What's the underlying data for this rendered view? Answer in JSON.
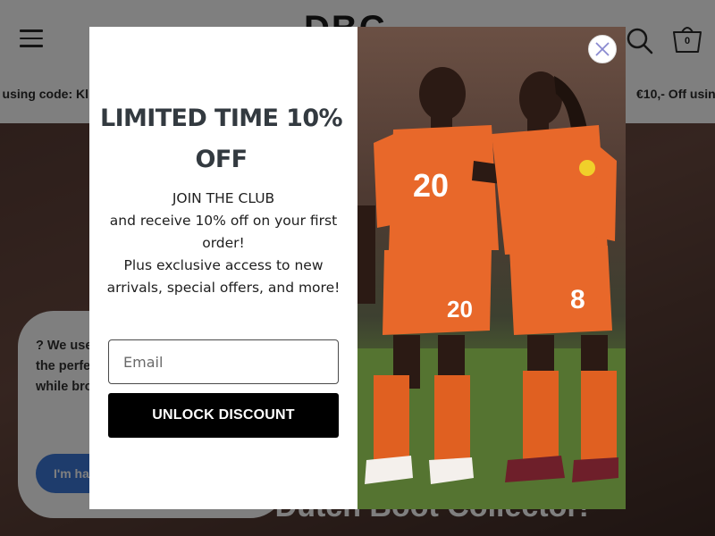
{
  "header": {
    "logo_text": "DBC",
    "cart_count": "0"
  },
  "announcement": {
    "left_text": "f using code: Kl",
    "right_text": "€10,- Off usin"
  },
  "hero": {
    "title": "Welcome to Dutch Boot Collector!"
  },
  "cookie_banner": {
    "text": "? We use cookies for rare finds and the perfect personalized experience while browsing",
    "accept_label": "I'm happy"
  },
  "popup": {
    "title": "LIMITED TIME 10% OFF",
    "line1": "JOIN THE CLUB",
    "line2": "and receive 10% off on your first order!",
    "line3": "Plus exclusive access to new arrivals, special offers, and more!",
    "email_placeholder": "Email",
    "email_value": "",
    "button_label": "UNLOCK DISCOUNT",
    "players": {
      "left_number": "20",
      "right_number": "8"
    }
  },
  "colors": {
    "jersey": "#e8682a",
    "overlay": "rgba(0,0,0,0.5)",
    "button_bg": "#000000",
    "close_x": "#8a8ad0"
  },
  "icons": [
    "menu-icon",
    "search-icon",
    "cart-icon",
    "close-icon"
  ]
}
